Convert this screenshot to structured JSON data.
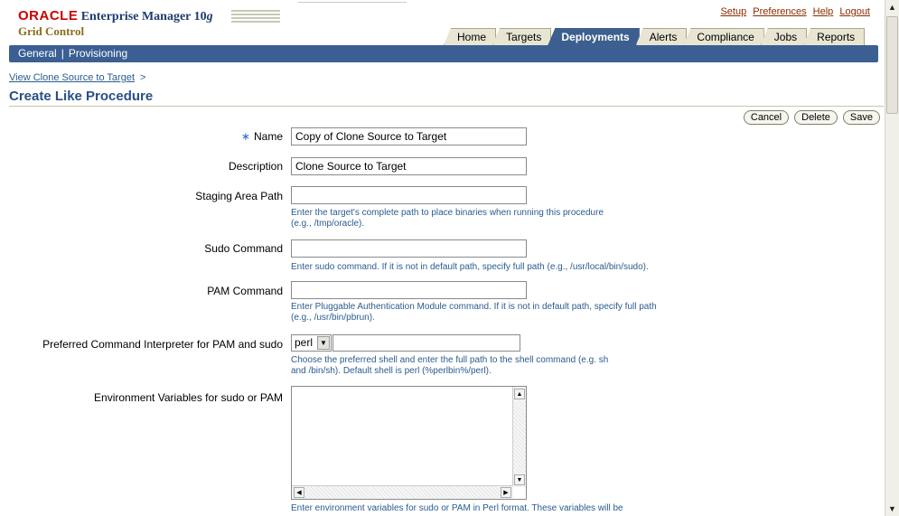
{
  "header": {
    "logo_oracle": "ORACLE",
    "logo_product": "Enterprise Manager 10",
    "logo_version": "g",
    "subtitle": "Grid Control",
    "global_links": [
      "Setup",
      "Preferences",
      "Help",
      "Logout"
    ]
  },
  "tabs": [
    {
      "label": "Home",
      "active": false
    },
    {
      "label": "Targets",
      "active": false
    },
    {
      "label": "Deployments",
      "active": true
    },
    {
      "label": "Alerts",
      "active": false
    },
    {
      "label": "Compliance",
      "active": false
    },
    {
      "label": "Jobs",
      "active": false
    },
    {
      "label": "Reports",
      "active": false
    }
  ],
  "subnav": {
    "items": [
      "General",
      "Provisioning"
    ],
    "separator": "|"
  },
  "breadcrumb": {
    "link": "View Clone Source to Target",
    "separator": ">"
  },
  "page_title": "Create Like Procedure",
  "buttons": {
    "cancel": "Cancel",
    "delete": "Delete",
    "save": "Save"
  },
  "form": {
    "name": {
      "required_mark": "∗",
      "label": "Name",
      "value": "Copy of Clone Source to Target"
    },
    "description": {
      "label": "Description",
      "value": "Clone Source to Target"
    },
    "staging": {
      "label": "Staging Area Path",
      "value": "",
      "hint_line1": "Enter the target's complete path to place binaries when running this procedure",
      "hint_line2": "(e.g., /tmp/oracle)."
    },
    "sudo": {
      "label": "Sudo Command",
      "value": "",
      "hint": "Enter sudo command. If it is not in default path, specify full path (e.g., /usr/local/bin/sudo)."
    },
    "pam": {
      "label": "PAM Command",
      "value": "",
      "hint_line1": "Enter Pluggable Authentication Module command. If it is not in default path, specify full path",
      "hint_line2": "(e.g., /usr/bin/pbrun)."
    },
    "interpreter": {
      "label": "Preferred Command Interpreter for PAM and sudo",
      "selected": "perl",
      "path_value": "",
      "hint_line1": "Choose the preferred shell and enter the full path to the shell command (e.g. sh",
      "hint_line2": "and /bin/sh). Default shell is perl (%perlbin%/perl)."
    },
    "env": {
      "label": "Environment Variables for sudo or PAM",
      "value": "",
      "hint": "Enter environment variables for sudo or PAM in Perl format. These variables will be"
    }
  },
  "icons": {
    "scroll_up": "up-arrow-icon",
    "scroll_down": "down-arrow-icon",
    "select_arrow": "chevron-down-icon"
  },
  "colors": {
    "brand_red": "#cc0000",
    "nav_blue": "#3b5f93",
    "title_blue": "#2a4f84",
    "hint_blue": "#2b5b8e",
    "link_brown": "#8a2c00"
  }
}
